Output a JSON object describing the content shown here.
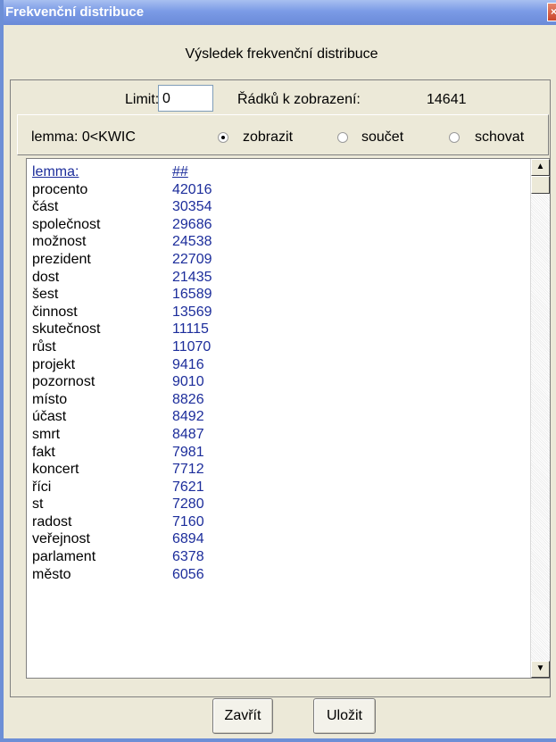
{
  "window": {
    "title": "Frekvenční distribuce",
    "close_icon": "×"
  },
  "heading": "Výsledek frekvenční distribuce",
  "filter": {
    "limit_label": "Limit:",
    "limit_value": "0",
    "rows_label": "Řádků k zobrazení:",
    "rows_value": "14641"
  },
  "options": {
    "field_label": "lemma: 0<KWIC",
    "choices": [
      {
        "label": "zobrazit",
        "selected": true
      },
      {
        "label": "součet",
        "selected": false
      },
      {
        "label": "schovat",
        "selected": false
      }
    ]
  },
  "table": {
    "headers": {
      "lemma": "lemma:",
      "count": "##"
    },
    "rows": [
      {
        "lemma": "procento",
        "count": "42016"
      },
      {
        "lemma": "část",
        "count": "30354"
      },
      {
        "lemma": "společnost",
        "count": "29686"
      },
      {
        "lemma": "možnost",
        "count": "24538"
      },
      {
        "lemma": "prezident",
        "count": "22709"
      },
      {
        "lemma": "dost",
        "count": "21435"
      },
      {
        "lemma": "šest",
        "count": "16589"
      },
      {
        "lemma": "činnost",
        "count": "13569"
      },
      {
        "lemma": "skutečnost",
        "count": "11115"
      },
      {
        "lemma": "růst",
        "count": "11070"
      },
      {
        "lemma": "projekt",
        "count": "9416"
      },
      {
        "lemma": "pozornost",
        "count": "9010"
      },
      {
        "lemma": "místo",
        "count": "8826"
      },
      {
        "lemma": "účast",
        "count": "8492"
      },
      {
        "lemma": "smrt",
        "count": "8487"
      },
      {
        "lemma": "fakt",
        "count": "7981"
      },
      {
        "lemma": "koncert",
        "count": "7712"
      },
      {
        "lemma": "říci",
        "count": "7621"
      },
      {
        "lemma": "st",
        "count": "7280"
      },
      {
        "lemma": "radost",
        "count": "7160"
      },
      {
        "lemma": "veřejnost",
        "count": "6894"
      },
      {
        "lemma": "parlament",
        "count": "6378"
      },
      {
        "lemma": "město",
        "count": "6056"
      }
    ]
  },
  "scrollbar": {
    "up_icon": "▲",
    "down_icon": "▼"
  },
  "buttons": {
    "close": "Zavřít",
    "save": "Uložit"
  }
}
